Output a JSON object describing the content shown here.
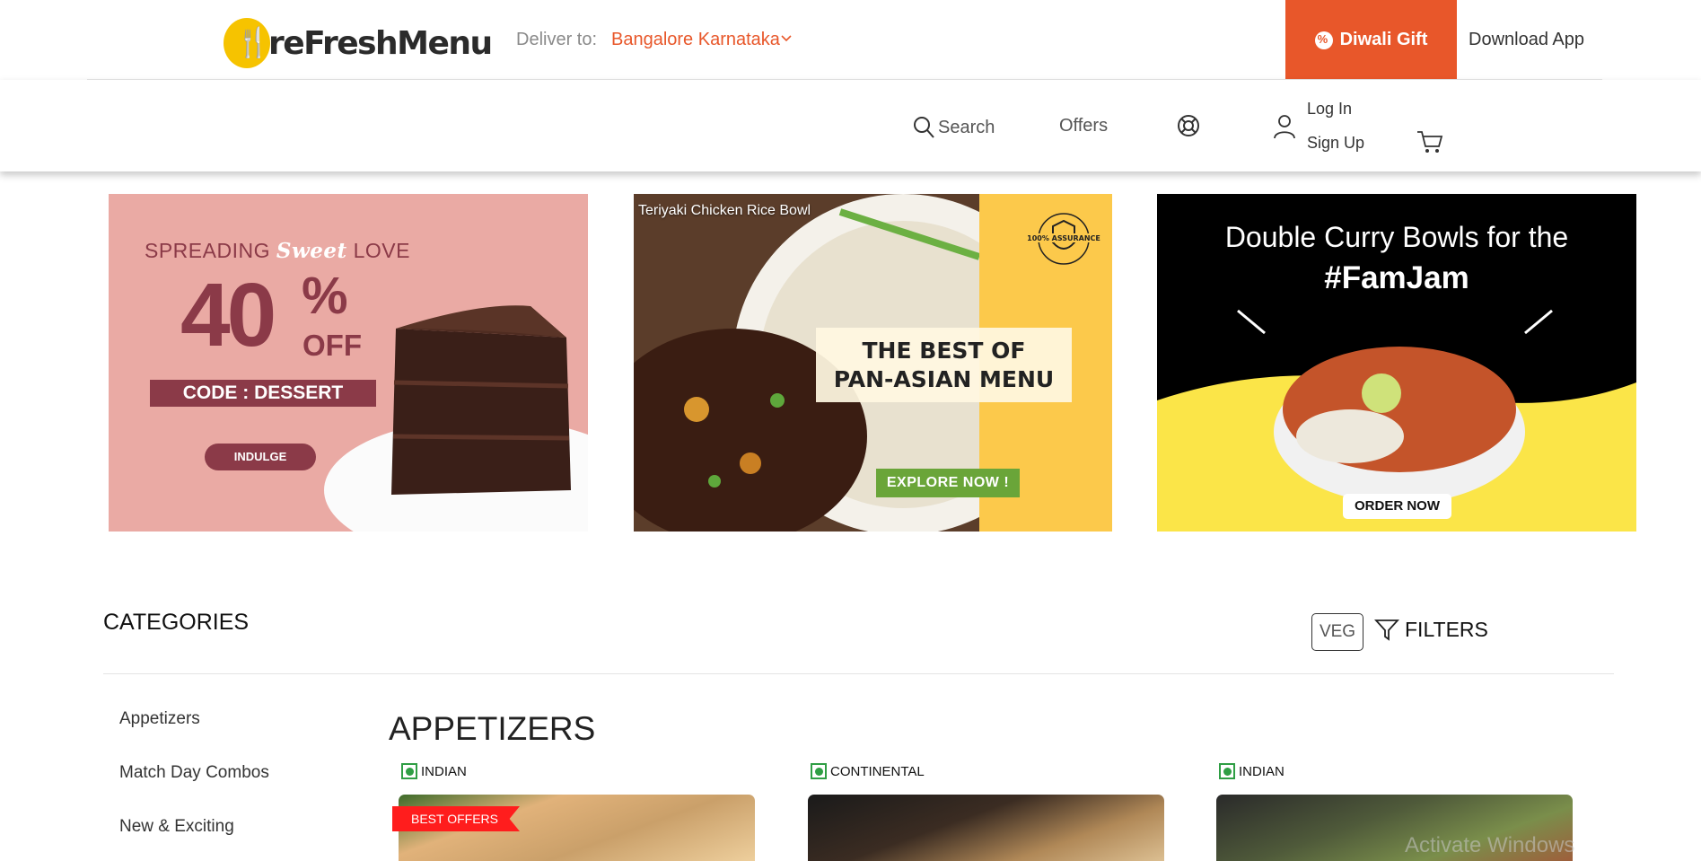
{
  "header": {
    "logo_text": "reFreshMenu",
    "deliver_label": "Deliver to:",
    "deliver_city": "Bangalore Karnataka",
    "gift_label": "Diwali Gift",
    "download_app": "Download App"
  },
  "nav": {
    "search": "Search",
    "offers": "Offers",
    "login": "Log In",
    "signup": "Sign Up"
  },
  "banners": {
    "dessert": {
      "spread_a": "SPREADING ",
      "sweet": "Sweet",
      "spread_b": " LOVE",
      "discount": "40",
      "percent": "%",
      "off": "OFF",
      "code": "CODE : DESSERT",
      "cta": "INDULGE"
    },
    "panasian": {
      "caption": "Teriyaki Chicken Rice Bowl",
      "badge": "100% ASSURANCE",
      "headline_1": "THE BEST OF",
      "headline_2": "PAN-ASIAN MENU",
      "cta": "EXPLORE NOW !"
    },
    "famjam": {
      "line_1": "Double Curry Bowls for the",
      "line_2": "#FamJam",
      "cta": "ORDER NOW"
    }
  },
  "categories": {
    "title": "CATEGORIES",
    "veg_label": "VEG",
    "filters_label": "FILTERS",
    "items": [
      "Appetizers",
      "Match Day Combos",
      "New & Exciting"
    ]
  },
  "section": {
    "title": "APPETIZERS",
    "cards": [
      {
        "cuisine": "INDIAN",
        "badge": "BEST OFFERS"
      },
      {
        "cuisine": "CONTINENTAL"
      },
      {
        "cuisine": "INDIAN"
      }
    ]
  },
  "watermark": "Activate Windows",
  "colors": {
    "accent": "#e8572a",
    "veg": "#2f9e44",
    "logo_yellow": "#f6c300",
    "best_offers": "#ff1d1d"
  }
}
